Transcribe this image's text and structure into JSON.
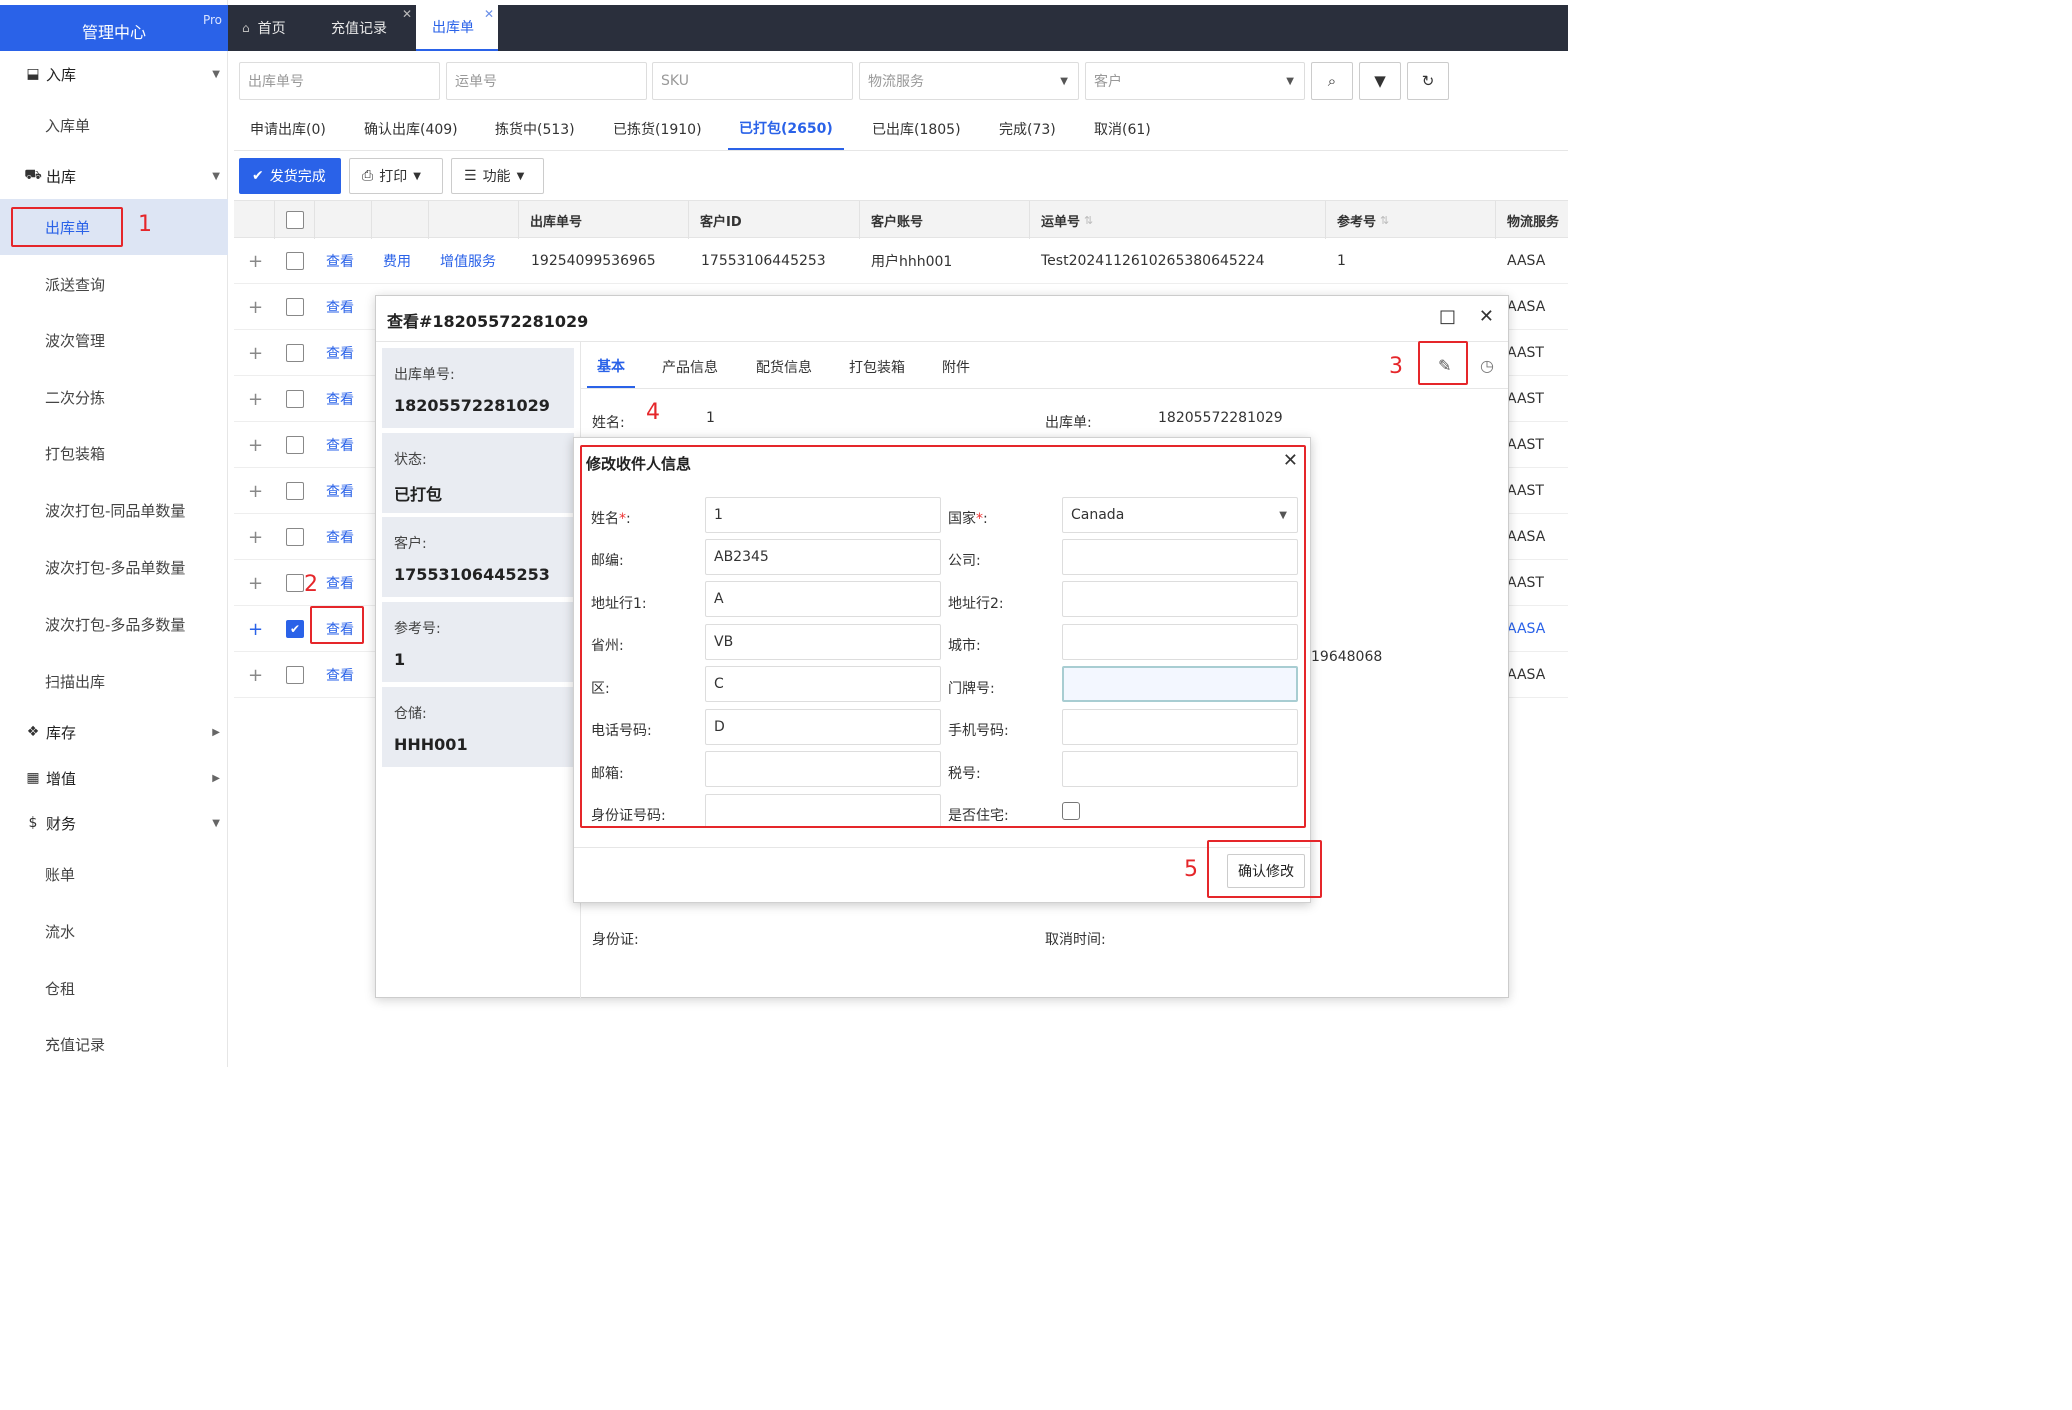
{
  "brand": {
    "name": "管理中心",
    "badge": "Pro"
  },
  "sidebar": {
    "groups": [
      {
        "label": "入库",
        "icon": "inbox-icon"
      },
      {
        "label": "出库",
        "icon": "truck-icon"
      },
      {
        "label": "库存",
        "icon": "cubes-icon"
      },
      {
        "label": "增值",
        "icon": "grid-icon"
      },
      {
        "label": "财务",
        "icon": "dollar-icon"
      }
    ],
    "inbound_items": [
      "入库单"
    ],
    "outbound_items": [
      "出库单",
      "派送查询",
      "波次管理",
      "二次分拣",
      "打包装箱",
      "波次打包-同品单数量",
      "波次打包-多品单数量",
      "波次打包-多品多数量",
      "扫描出库"
    ],
    "finance_items": [
      "账单",
      "流水",
      "仓租",
      "充值记录"
    ]
  },
  "top_tabs": [
    {
      "label": "首页"
    },
    {
      "label": "充值记录"
    },
    {
      "label": "出库单"
    }
  ],
  "filters": {
    "order_no": "出库单号",
    "waybill": "运单号",
    "sku": "SKU",
    "logistics": "物流服务",
    "customer": "客户"
  },
  "status_tabs": [
    "申请出库(0)",
    "确认出库(409)",
    "拣货中(513)",
    "已拣货(1910)",
    "已打包(2650)",
    "已出库(1805)",
    "完成(73)",
    "取消(61)"
  ],
  "actions": {
    "ship_done": "发货完成",
    "print": "打印",
    "function": "功能"
  },
  "table": {
    "headers": [
      "出库单号",
      "客户ID",
      "客户账号",
      "运单号",
      "参考号",
      "物流服务"
    ],
    "link_view": "查看",
    "link_fee": "费用",
    "link_vas": "增值服务",
    "first_row": {
      "order_no": "19254099536965",
      "customer_id": "17553106445253",
      "account": "用户hhh001",
      "waybill": "Test20241126102653806452​24",
      "ref": "1",
      "logistics": "AASA"
    },
    "row_logistics": [
      "AASA",
      "AAST",
      "AAST",
      "AAST",
      "AAST",
      "AASA",
      "AAST",
      "AASA",
      "AASA"
    ]
  },
  "view_modal": {
    "title": "查看#18205572281029",
    "cards": [
      {
        "label": "出库单号:",
        "value": "18205572281029"
      },
      {
        "label": "状态:",
        "value": "已打包"
      },
      {
        "label": "客户:",
        "value": "17553106445253"
      },
      {
        "label": "参考号:",
        "value": "1"
      },
      {
        "label": "仓储:",
        "value": "HHH001"
      }
    ],
    "tabs": [
      "基本",
      "产品信息",
      "配货信息",
      "打包装箱",
      "附件"
    ],
    "name_label": "姓名:",
    "name_value": "1",
    "order_label": "出库单:",
    "order_value": "18205572281029",
    "partial_value": "19648068",
    "id_label": "身份证:",
    "cancel_time_label": "取消时间:"
  },
  "edit_modal": {
    "title": "修改收件人信息",
    "fields": {
      "name": {
        "label": "姓名",
        "value": "1"
      },
      "country": {
        "label": "国家",
        "value": "Canada"
      },
      "postcode": {
        "label": "邮编:",
        "value": "AB2345"
      },
      "company": {
        "label": "公司:",
        "value": ""
      },
      "addr1": {
        "label": "地址行1:",
        "value": "A"
      },
      "addr2": {
        "label": "地址行2:",
        "value": ""
      },
      "province": {
        "label": "省州:",
        "value": "VB"
      },
      "city": {
        "label": "城市:",
        "value": ""
      },
      "district": {
        "label": "区:",
        "value": "C"
      },
      "door": {
        "label": "门牌号:",
        "value": ""
      },
      "phone": {
        "label": "电话号码:",
        "value": "D"
      },
      "mobile": {
        "label": "手机号码:",
        "value": ""
      },
      "email": {
        "label": "邮箱:",
        "value": ""
      },
      "tax": {
        "label": "税号:",
        "value": ""
      },
      "idcard": {
        "label": "身份证号码:",
        "value": ""
      },
      "residential": {
        "label": "是否住宅:"
      }
    },
    "required_mark": "*",
    "colon": ":",
    "confirm": "确认修改"
  },
  "annotations": [
    "1",
    "2",
    "3",
    "4",
    "5"
  ],
  "colors": {
    "primary": "#2a62e8",
    "topbar": "#2a2f3c",
    "annotation": "#e5262a"
  }
}
